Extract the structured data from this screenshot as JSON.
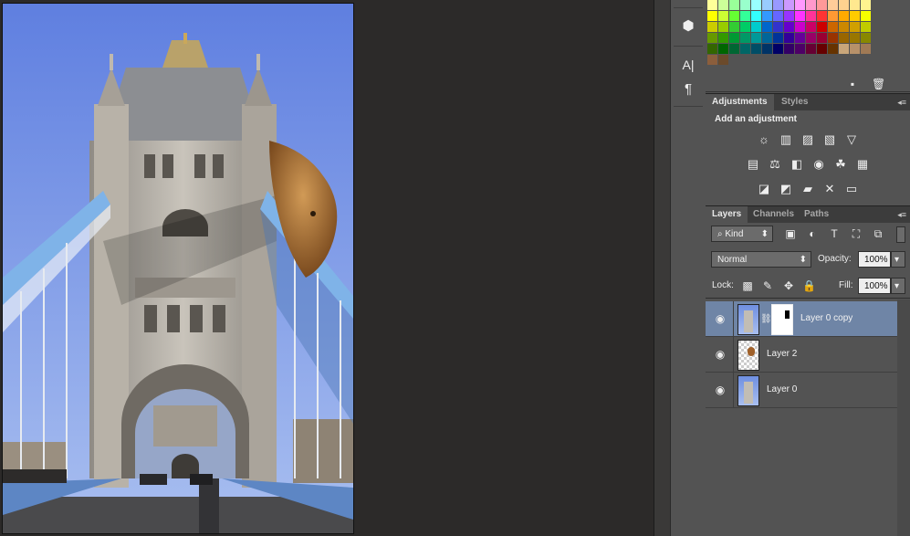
{
  "toolstrip": {
    "items": [
      {
        "icon": "3d-cube-icon",
        "glyph": "⬢"
      },
      {
        "icon": "character-icon",
        "glyph": "A|"
      },
      {
        "icon": "paragraph-icon",
        "glyph": "¶"
      }
    ]
  },
  "swatches": {
    "rows": [
      [
        "#ffff99",
        "#ccff99",
        "#99ff99",
        "#99ffcc",
        "#99ffff",
        "#99ccff",
        "#9999ff",
        "#cc99ff",
        "#ff99ff",
        "#ff99cc",
        "#ff9999",
        "#ffcc99",
        "#ffd28f",
        "#ffe88f",
        "#fff38f"
      ],
      [
        "#ffff00",
        "#ccff33",
        "#66ff33",
        "#33ff99",
        "#33ffff",
        "#3399ff",
        "#6666ff",
        "#9933ff",
        "#ff33ff",
        "#ff3399",
        "#ff3333",
        "#ff9933",
        "#ffaa00",
        "#ffcc00",
        "#f6ff00"
      ],
      [
        "#cccc00",
        "#99cc00",
        "#33cc33",
        "#00cc66",
        "#00cccc",
        "#0066cc",
        "#3333cc",
        "#6600cc",
        "#cc00cc",
        "#cc0066",
        "#cc0000",
        "#cc6600",
        "#cc8800",
        "#d0a000",
        "#c0cc00"
      ],
      [
        "#669900",
        "#339900",
        "#009933",
        "#009966",
        "#009999",
        "#006699",
        "#003399",
        "#330099",
        "#660099",
        "#990066",
        "#990033",
        "#993300",
        "#996600",
        "#997700",
        "#888800"
      ],
      [
        "#336600",
        "#006600",
        "#006633",
        "#006666",
        "#004d66",
        "#003366",
        "#000066",
        "#330066",
        "#4d0066",
        "#660033",
        "#660000",
        "#663300",
        "#c9a67a",
        "#b7916a",
        "#a07a55"
      ],
      [
        "#8b5e3c",
        "#6b4a2b"
      ]
    ]
  },
  "adjustments": {
    "tabs": [
      "Adjustments",
      "Styles"
    ],
    "heading": "Add an adjustment",
    "rows": [
      [
        "brightness-contrast-icon",
        "levels-icon",
        "curves-icon",
        "exposure-icon",
        "vibrance-icon"
      ],
      [
        "hue-saturation-icon",
        "color-balance-icon",
        "black-white-icon",
        "photo-filter-icon",
        "channel-mixer-icon",
        "color-lookup-icon"
      ],
      [
        "invert-icon",
        "posterize-icon",
        "threshold-icon",
        "selective-color-icon",
        "gradient-map-icon"
      ]
    ],
    "glyphs": [
      [
        "☼",
        "▥",
        "▨",
        "▧",
        "▽"
      ],
      [
        "▤",
        "⚖",
        "◧",
        "◉",
        "☘",
        "▦"
      ],
      [
        "◪",
        "◩",
        "▰",
        "✕",
        "▭"
      ]
    ]
  },
  "layers_panel": {
    "tabs": [
      "Layers",
      "Channels",
      "Paths"
    ],
    "filter_label": "Kind",
    "blend_mode": "Normal",
    "opacity_label": "Opacity:",
    "opacity_value": "100%",
    "lock_label": "Lock:",
    "fill_label": "Fill:",
    "fill_value": "100%",
    "layers": [
      {
        "name": "Layer 0 copy",
        "selected": true,
        "thumb": "photo",
        "has_mask": true
      },
      {
        "name": "Layer 2",
        "selected": false,
        "thumb": "dragon",
        "has_mask": false
      },
      {
        "name": "Layer 0",
        "selected": false,
        "thumb": "photo",
        "has_mask": false
      }
    ]
  },
  "colors": {
    "panel_bg": "#535353",
    "tab_bar": "#3c3c3c",
    "selected_layer": "#6f85a6",
    "canvas_bg": "#2c2a29",
    "sky": "#6f8fe0",
    "bridge_blue": "#7fb3e8"
  }
}
